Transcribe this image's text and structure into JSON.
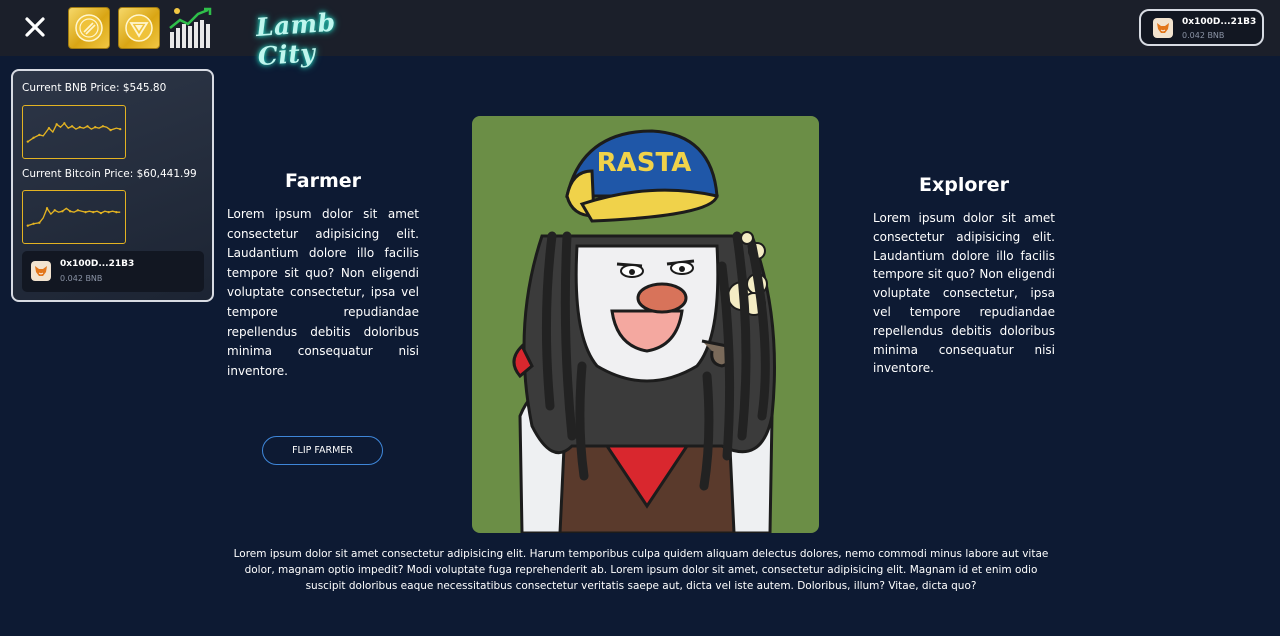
{
  "topbar": {
    "close_icon": "close-icon",
    "coins": [
      "bnb-coin-icon",
      "token-coin-icon"
    ],
    "stats_icon": "stats-chart-icon",
    "logo_text": "Lamb City",
    "wallet": {
      "address": "0x100D...21B3",
      "balance": "0.042 BNB",
      "icon": "metamask-fox-icon"
    }
  },
  "price_panel": {
    "bnb_label": "Current BNB Price: $545.80",
    "btc_label": "Current Bitcoin Price: $60,441.99",
    "wallet": {
      "address": "0x100D...21B3",
      "balance": "0.042 BNB"
    }
  },
  "farmer": {
    "title": "Farmer",
    "text": "Lorem ipsum dolor sit amet consectetur adipisicing elit. Laudantium dolore illo facilis tempore sit quo? Non eligendi voluptate consectetur, ipsa vel tempore repudiandae repellendus debitis doloribus minima consequatur nisi inventore.",
    "button_label": "FLIP FARMER"
  },
  "explorer": {
    "title": "Explorer",
    "text": "Lorem ipsum dolor sit amet consectetur adipisicing elit. Laudantium dolore illo facilis tempore sit quo? Non eligendi voluptate consectetur, ipsa vel tempore repudiandae repellendus debitis doloribus minima consequatur nisi inventore."
  },
  "artwork": {
    "cap_text": "RASTA",
    "background": "#6b8e46"
  },
  "footer": {
    "text": "Lorem ipsum dolor sit amet consectetur adipisicing elit. Harum temporibus culpa quidem aliquam delectus dolores, nemo commodi minus labore aut vitae dolor, magnam optio impedit? Modi voluptate fuga reprehenderit ab. Lorem ipsum dolor sit amet, consectetur adipisicing elit. Magnam id et enim odio suscipit doloribus eaque necessitatibus consectetur veritatis saepe aut, dicta vel iste autem. Doloribus, illum? Vitae, dicta quo?"
  },
  "colors": {
    "background": "#0d1a33",
    "topbar": "#1b1f2a",
    "accent_gold": "#e3b322",
    "button_border": "#3e86d8"
  }
}
